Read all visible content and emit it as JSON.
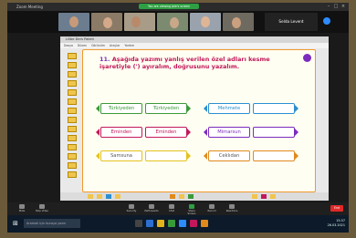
{
  "window": {
    "title": "Zoom Meeting"
  },
  "banner": {
    "text": "You are viewing Jale's screen"
  },
  "participants": {
    "host_name": "Selda Levent"
  },
  "app": {
    "title": "Lilibe Ders Paketi",
    "menu": [
      "Dosya",
      "Düzen",
      "Görünüm",
      "Araçlar",
      "Yardım"
    ]
  },
  "worksheet": {
    "number": "11.",
    "instruction": "Aşağıda yazımı yanlış verilen özel adları kesme işaretiyle (') ayıralım, doğrusunu yazalım.",
    "rows": [
      {
        "left": "Türkiyeden",
        "left_answer": "Türkiyeden",
        "right": "Mehmete",
        "right_answer": "",
        "color": "#3a9a3a",
        "right_color": "#2b8fd1"
      },
      {
        "left": "Eminden",
        "left_answer": "Eminden",
        "right": "Mimarsun",
        "right_answer": "",
        "color": "#c2185b",
        "right_color": "#7b2cbf"
      },
      {
        "left": "Samsuna",
        "left_answer": "",
        "right": "Ceklıdan",
        "right_answer": "",
        "color": "#e3c21c",
        "right_color": "#e08a1c"
      }
    ]
  },
  "controls": {
    "items": [
      "Mute",
      "Stop Video",
      "Security",
      "Participants",
      "Chat",
      "Share Screen",
      "Record",
      "Reactions"
    ],
    "end": "End"
  },
  "taskbar": {
    "search": "Aramak için buraya yazın",
    "time": "15:37",
    "date": "26.03.2021"
  }
}
